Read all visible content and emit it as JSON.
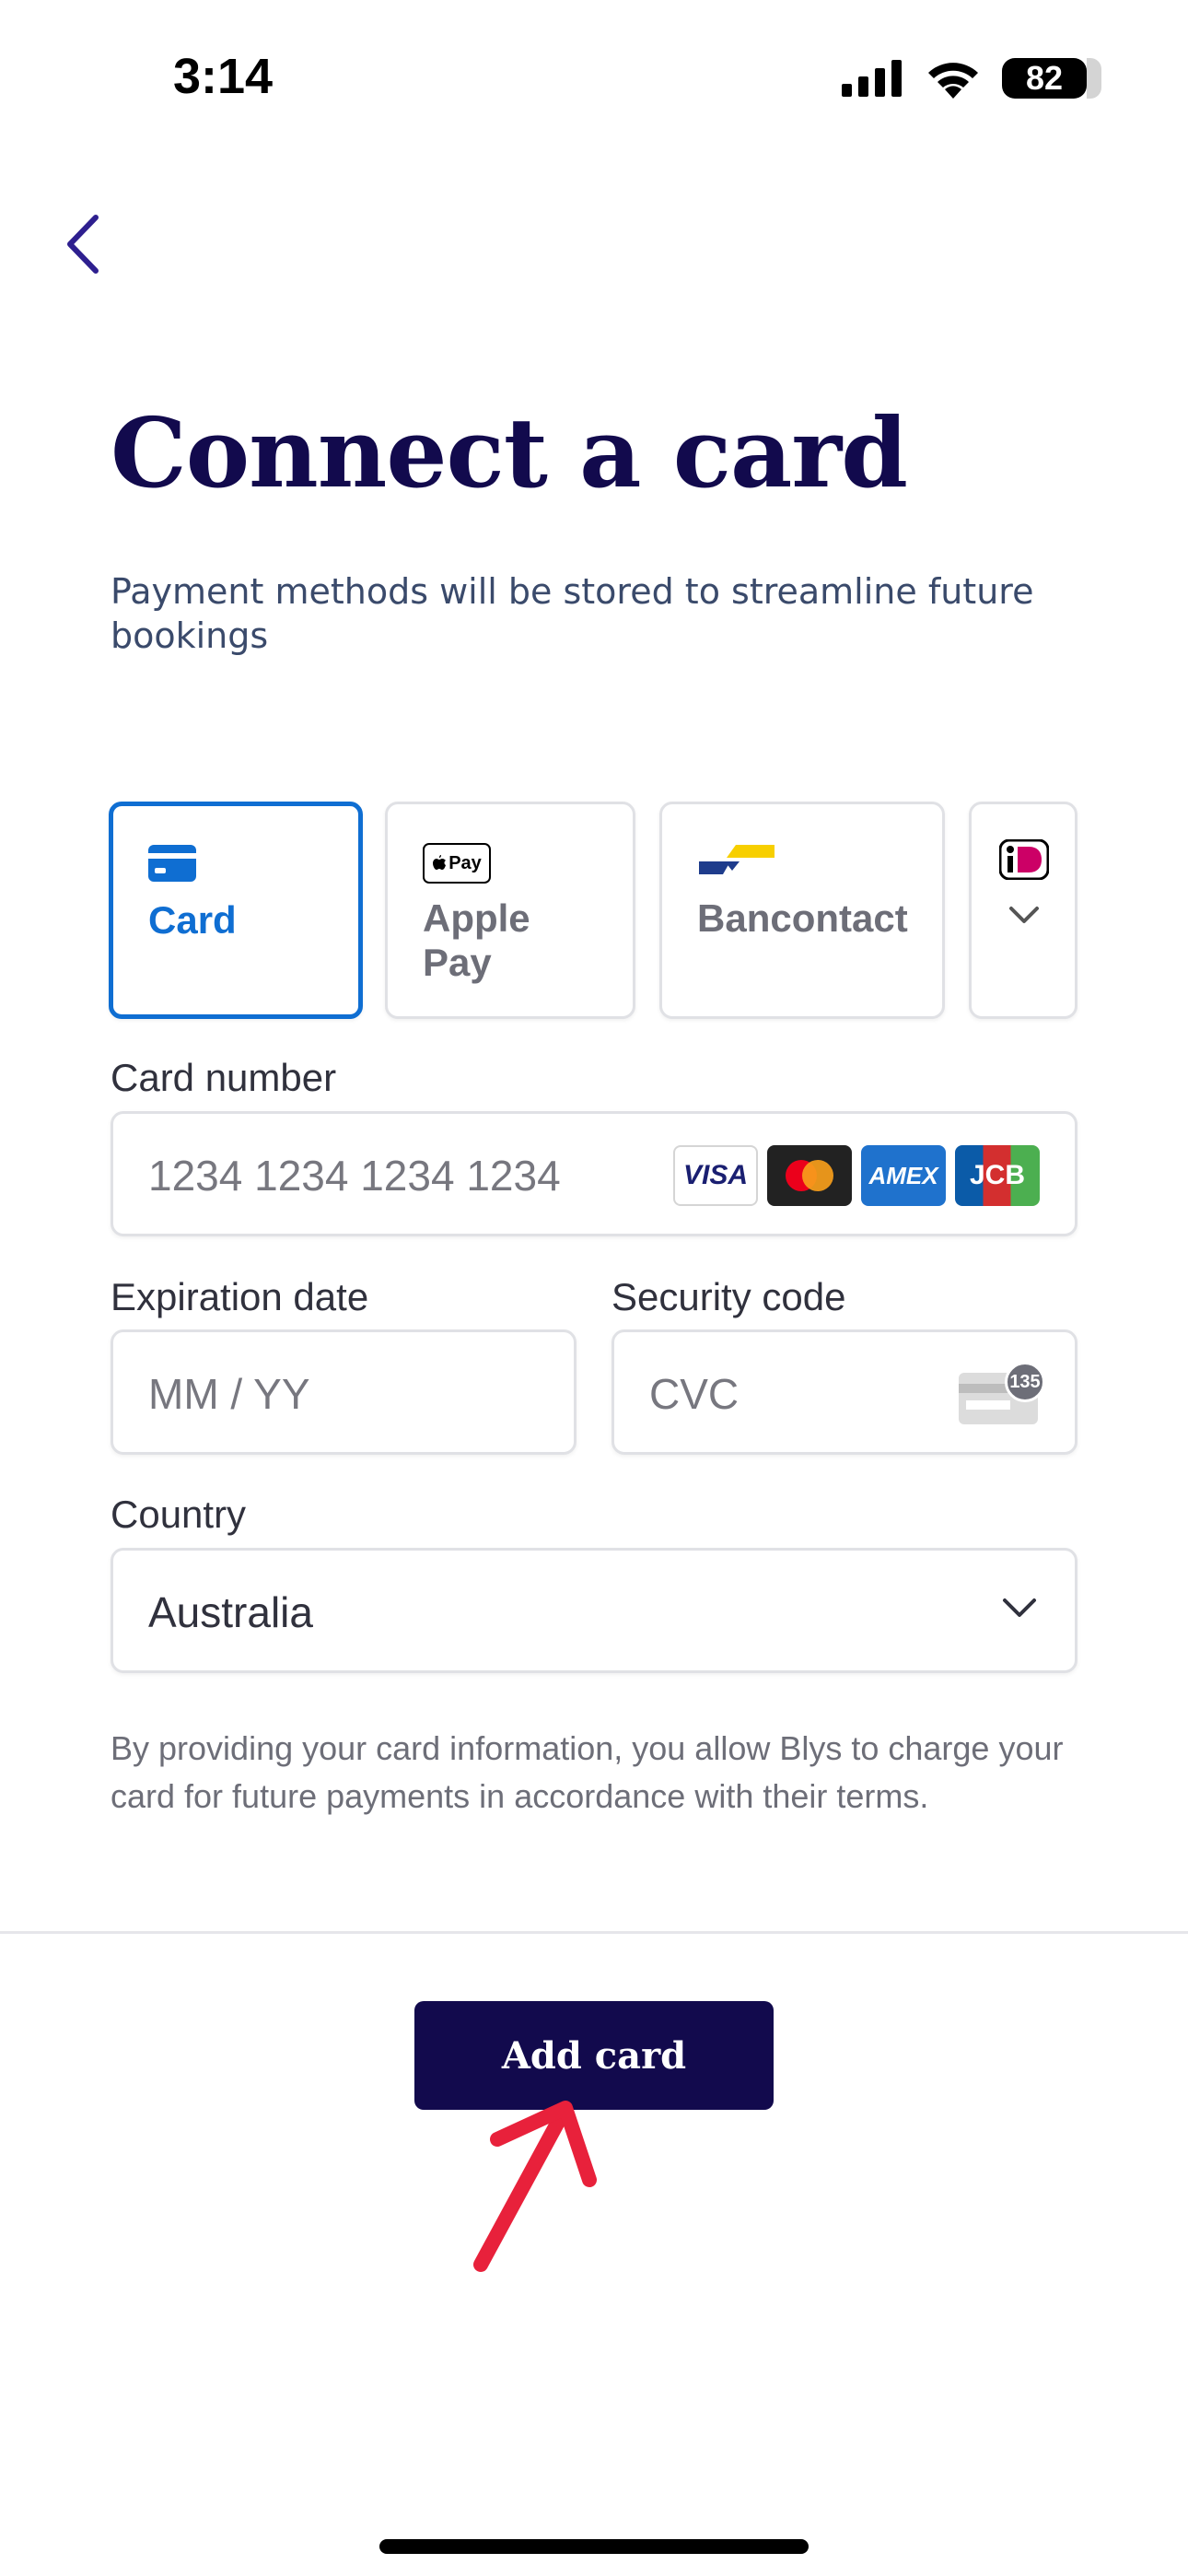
{
  "status_bar": {
    "time": "3:14",
    "battery": "82"
  },
  "header": {
    "title": "Connect a card",
    "subtitle": "Payment methods will be stored to streamline future bookings"
  },
  "payment_methods": [
    {
      "label": "Card",
      "selected": true,
      "icon": "card-icon"
    },
    {
      "label": "Apple Pay",
      "selected": false,
      "icon": "apple-pay-icon"
    },
    {
      "label": "Bancontact",
      "selected": false,
      "icon": "bancontact-icon"
    },
    {
      "label": "",
      "selected": false,
      "icon": "ideal-icon"
    }
  ],
  "apple_pay_badge": "Pay",
  "card_brands": [
    "VISA",
    "AMEX",
    "JCB"
  ],
  "form": {
    "card_number_label": "Card number",
    "card_number_placeholder": "1234 1234 1234 1234",
    "expiry_label": "Expiration date",
    "expiry_placeholder": "MM / YY",
    "cvc_label": "Security code",
    "cvc_placeholder": "CVC",
    "cvc_badge": "135",
    "country_label": "Country",
    "country_value": "Australia"
  },
  "disclaimer": "By providing your card information, you allow Blys to charge your card for future payments in accordance with their terms.",
  "actions": {
    "add_card_label": "Add card"
  },
  "colors": {
    "brand_dark": "#120a4d",
    "accent_blue": "#0f6ed2",
    "annotation_red": "#e8213b"
  }
}
